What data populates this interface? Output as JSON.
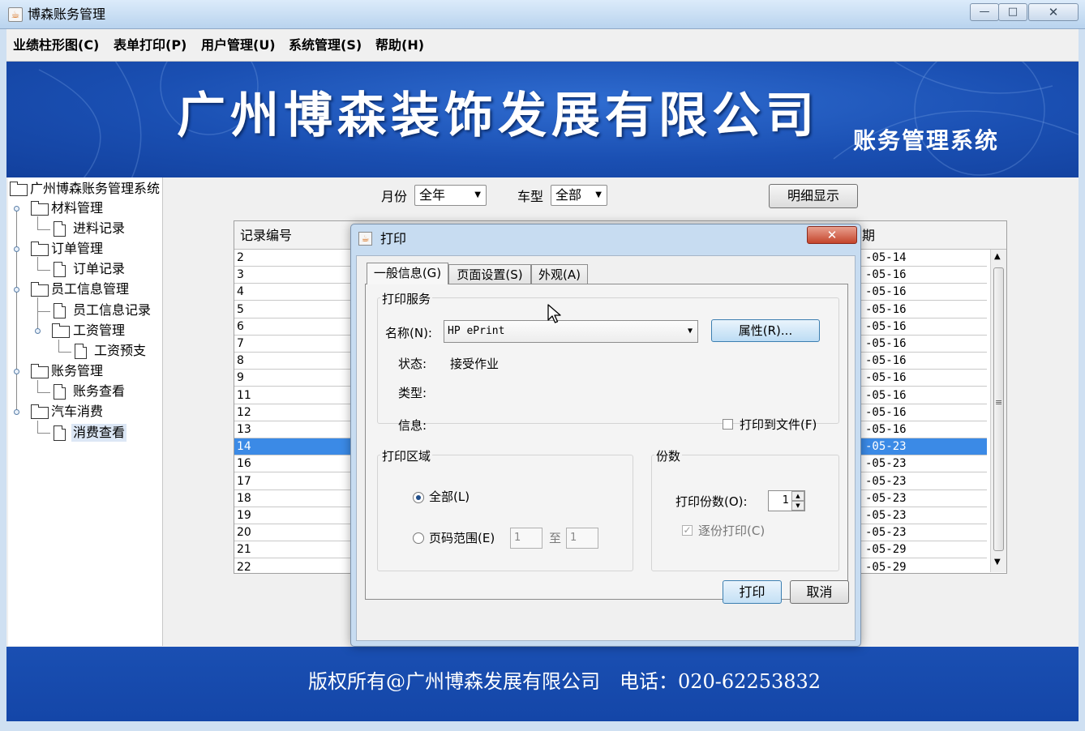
{
  "window": {
    "title": "博森账务管理",
    "controls": {
      "minimize": "—",
      "maximize": "□",
      "close": "✕"
    }
  },
  "menu": [
    "业绩柱形图(C)",
    "表单打印(P)",
    "用户管理(U)",
    "系统管理(S)",
    "帮助(H)"
  ],
  "banner": {
    "company": "广州博森装饰发展有限公司",
    "system": "账务管理系统"
  },
  "tree": {
    "root": "广州博森账务管理系统",
    "nodes": [
      {
        "label": "材料管理",
        "type": "folder"
      },
      {
        "label": "进料记录",
        "type": "file"
      },
      {
        "label": "订单管理",
        "type": "folder"
      },
      {
        "label": "订单记录",
        "type": "file"
      },
      {
        "label": "员工信息管理",
        "type": "folder"
      },
      {
        "label": "员工信息记录",
        "type": "file"
      },
      {
        "label": "工资管理",
        "type": "folder"
      },
      {
        "label": "工资预支",
        "type": "file"
      },
      {
        "label": "账务管理",
        "type": "folder"
      },
      {
        "label": "账务查看",
        "type": "file"
      },
      {
        "label": "汽车消费",
        "type": "folder"
      },
      {
        "label": "消费查看",
        "type": "file",
        "selected": true
      }
    ]
  },
  "toolbar": {
    "month_label": "月份",
    "month_value": "全年",
    "car_label": "车型",
    "car_value": "全部",
    "detail_button": "明细显示"
  },
  "table": {
    "col_id": "记录编号",
    "col_date_partial": "期",
    "selected_row": "14",
    "rows": [
      {
        "id": "2",
        "date": "-05-14"
      },
      {
        "id": "3",
        "date": "-05-16"
      },
      {
        "id": "4",
        "date": "-05-16"
      },
      {
        "id": "5",
        "date": "-05-16"
      },
      {
        "id": "6",
        "date": "-05-16"
      },
      {
        "id": "7",
        "date": "-05-16"
      },
      {
        "id": "8",
        "date": "-05-16"
      },
      {
        "id": "9",
        "date": "-05-16"
      },
      {
        "id": "11",
        "date": "-05-16"
      },
      {
        "id": "12",
        "date": "-05-16"
      },
      {
        "id": "13",
        "date": "-05-16"
      },
      {
        "id": "14",
        "date": "-05-23"
      },
      {
        "id": "16",
        "date": "-05-23"
      },
      {
        "id": "17",
        "date": "-05-23"
      },
      {
        "id": "18",
        "date": "-05-23"
      },
      {
        "id": "19",
        "date": "-05-23"
      },
      {
        "id": "20",
        "date": "-05-23"
      },
      {
        "id": "21",
        "date": "-05-29"
      },
      {
        "id": "22",
        "date": "-05-29"
      }
    ],
    "scroll_grip": "≡"
  },
  "footer": {
    "text": "版权所有@广州博森发展有限公司　电话：020-62253832"
  },
  "print_dialog": {
    "title": "打印",
    "close": "✕",
    "tabs": [
      "一般信息(G)",
      "页面设置(S)",
      "外观(A)"
    ],
    "active_tab": 0,
    "service": {
      "group_title": "打印服务",
      "name_label": "名称(N):",
      "printer": "HP ePrint",
      "properties_button": "属性(R)...",
      "status_label": "状态:",
      "status_value": "接受作业",
      "type_label": "类型:",
      "info_label": "信息:",
      "print_to_file": "打印到文件(F)",
      "print_to_file_checked": false
    },
    "range": {
      "group_title": "打印区域",
      "all": "全部(L)",
      "pages": "页码范围(E)",
      "from": "1",
      "to_label": "至",
      "to": "1",
      "selected": "all"
    },
    "copies": {
      "group_title": "份数",
      "copies_label": "打印份数(O):",
      "copies_value": "1",
      "collate": "逐份打印(C)",
      "collate_checked": true,
      "collate_enabled": false
    },
    "buttons": {
      "print": "打印",
      "cancel": "取消"
    }
  },
  "icons": {
    "app": "java-icon",
    "folder": "folder-icon",
    "file": "file-icon",
    "cursor": "arrow-cursor-icon"
  },
  "colors": {
    "banner_blue": "#1a4fb2",
    "selection_blue": "#3b8ae6",
    "tree_selection": "#dce7f5",
    "dialog_frame": "#c7dcf1",
    "close_red": "#c4452c"
  }
}
